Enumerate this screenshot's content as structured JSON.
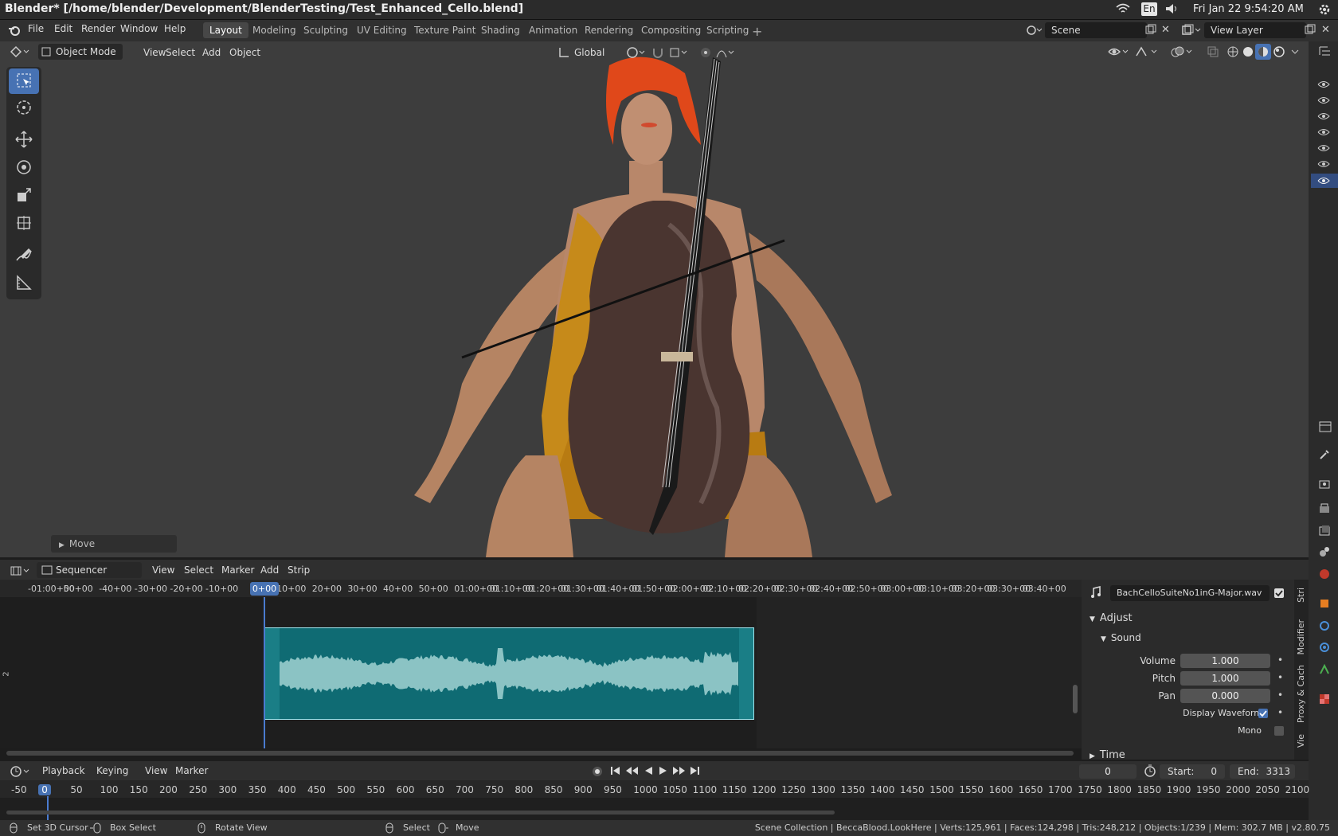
{
  "os": {
    "window_title": "Blender* [/home/blender/Development/BlenderTesting/Test_Enhanced_Cello.blend]",
    "lang": "En",
    "clock": "Fri Jan 22  9:54:20 AM"
  },
  "topbar": {
    "menus": [
      "File",
      "Edit",
      "Render",
      "Window",
      "Help"
    ],
    "workspaces": [
      "Layout",
      "Modeling",
      "Sculpting",
      "UV Editing",
      "Texture Paint",
      "Shading",
      "Animation",
      "Rendering",
      "Compositing",
      "Scripting"
    ],
    "active_workspace": "Layout",
    "scene": "Scene",
    "view_layer": "View Layer"
  },
  "viewport": {
    "mode": "Object Mode",
    "menus": [
      "View",
      "Select",
      "Add",
      "Object"
    ],
    "orientation": "Global",
    "last_op": "Move"
  },
  "sequencer": {
    "editor": "Sequencer",
    "menus": [
      "View",
      "Select",
      "Marker",
      "Add",
      "Strip"
    ],
    "ruler": [
      "-01:00+00",
      "50+00",
      "-40+00",
      "-30+00",
      "-20+00",
      "-10+00",
      "0+00",
      "10+00",
      "20+00",
      "30+00",
      "40+00",
      "50+00",
      "01:00+00",
      "01:10+00",
      "01:20+00",
      "01:30+00",
      "01:40+00",
      "01:50+00",
      "02:00+00",
      "02:10+00",
      "02:20+00",
      "02:30+00",
      "02:40+00",
      "02:50+00",
      "03:00+00",
      "03:10+00",
      "03:20+00",
      "03:30+00",
      "03:40+00"
    ],
    "current": "0+00",
    "channel": "2"
  },
  "sidepanel": {
    "strip_name": "BachCelloSuiteNo1inG-Major.wav",
    "adjust": "Adjust",
    "sound": "Sound",
    "volume_label": "Volume",
    "volume": "1.000",
    "pitch_label": "Pitch",
    "pitch": "1.000",
    "pan_label": "Pan",
    "pan": "0.000",
    "display_waveform": "Display Waveform",
    "display_waveform_checked": true,
    "mono": "Mono",
    "mono_checked": false,
    "time": "Time",
    "tabs": [
      "Stri",
      "Modifier",
      "Proxy & Cach",
      "Vie"
    ]
  },
  "timeline": {
    "menus": [
      "Playback",
      "Keying",
      "View",
      "Marker"
    ],
    "current_frame": "0",
    "start_label": "Start:",
    "start": "0",
    "end_label": "End:",
    "end": "3313",
    "ruler": [
      "-50",
      "0",
      "50",
      "100",
      "150",
      "200",
      "250",
      "300",
      "350",
      "400",
      "450",
      "500",
      "550",
      "600",
      "650",
      "700",
      "750",
      "800",
      "850",
      "900",
      "950",
      "1000",
      "1050",
      "1100",
      "1150",
      "1200",
      "1250",
      "1300",
      "1350",
      "1400",
      "1450",
      "1500",
      "1550",
      "1600",
      "1650",
      "1700",
      "1750",
      "1800",
      "1850",
      "1900",
      "1950",
      "2000",
      "2050",
      "2100"
    ]
  },
  "status": {
    "hint1": "Set 3D Cursor",
    "hint2": "Box Select",
    "hint3": "Rotate View",
    "hint4": "Select",
    "hint5": "Move",
    "stats": "Scene Collection | BeccaBlood.LookHere | Verts:125,961 | Faces:124,298 | Tris:248,212 | Objects:1/239 | Mem: 302.7 MB | v2.80.75"
  }
}
